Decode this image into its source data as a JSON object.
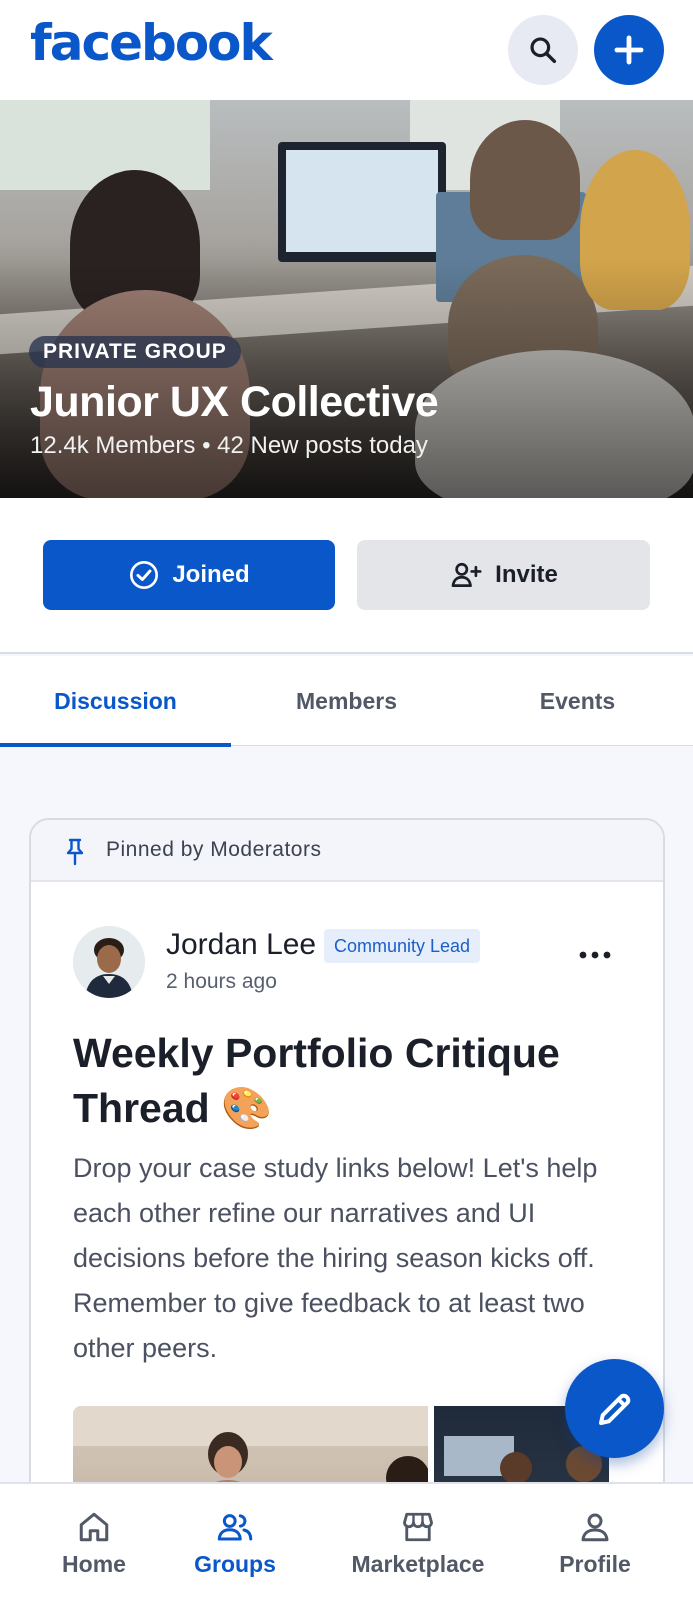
{
  "app": {
    "logo_text": "facebook"
  },
  "topbar": {
    "search_icon": "search-icon",
    "add_icon": "plus-icon"
  },
  "group": {
    "privacy_label": "PRIVATE GROUP",
    "name": "Junior UX Collective",
    "stats": "12.4k Members • 42 New posts today"
  },
  "actions": {
    "joined_label": "Joined",
    "invite_label": "Invite"
  },
  "tabs": [
    {
      "label": "Discussion",
      "active": true
    },
    {
      "label": "Members",
      "active": false
    },
    {
      "label": "Events",
      "active": false
    }
  ],
  "post": {
    "pinned_label": "Pinned by Moderators",
    "author": "Jordan Lee",
    "role": "Community Lead",
    "time": "2 hours ago",
    "title": "Weekly Portfolio Critique Thread 🎨",
    "body": "Drop your case study links below! Let's help each other refine our narratives and UI decisions before the hiring season kicks off. Remember to give feedback to at least two other peers."
  },
  "bottom_nav": [
    {
      "label": "Home",
      "icon": "home-icon",
      "active": false
    },
    {
      "label": "Groups",
      "icon": "groups-icon",
      "active": true
    },
    {
      "label": "Marketplace",
      "icon": "store-icon",
      "active": false
    },
    {
      "label": "Profile",
      "icon": "person-icon",
      "active": false
    }
  ],
  "colors": {
    "brand": "#0a57c9",
    "text": "#1b1f29",
    "muted": "#515866"
  }
}
